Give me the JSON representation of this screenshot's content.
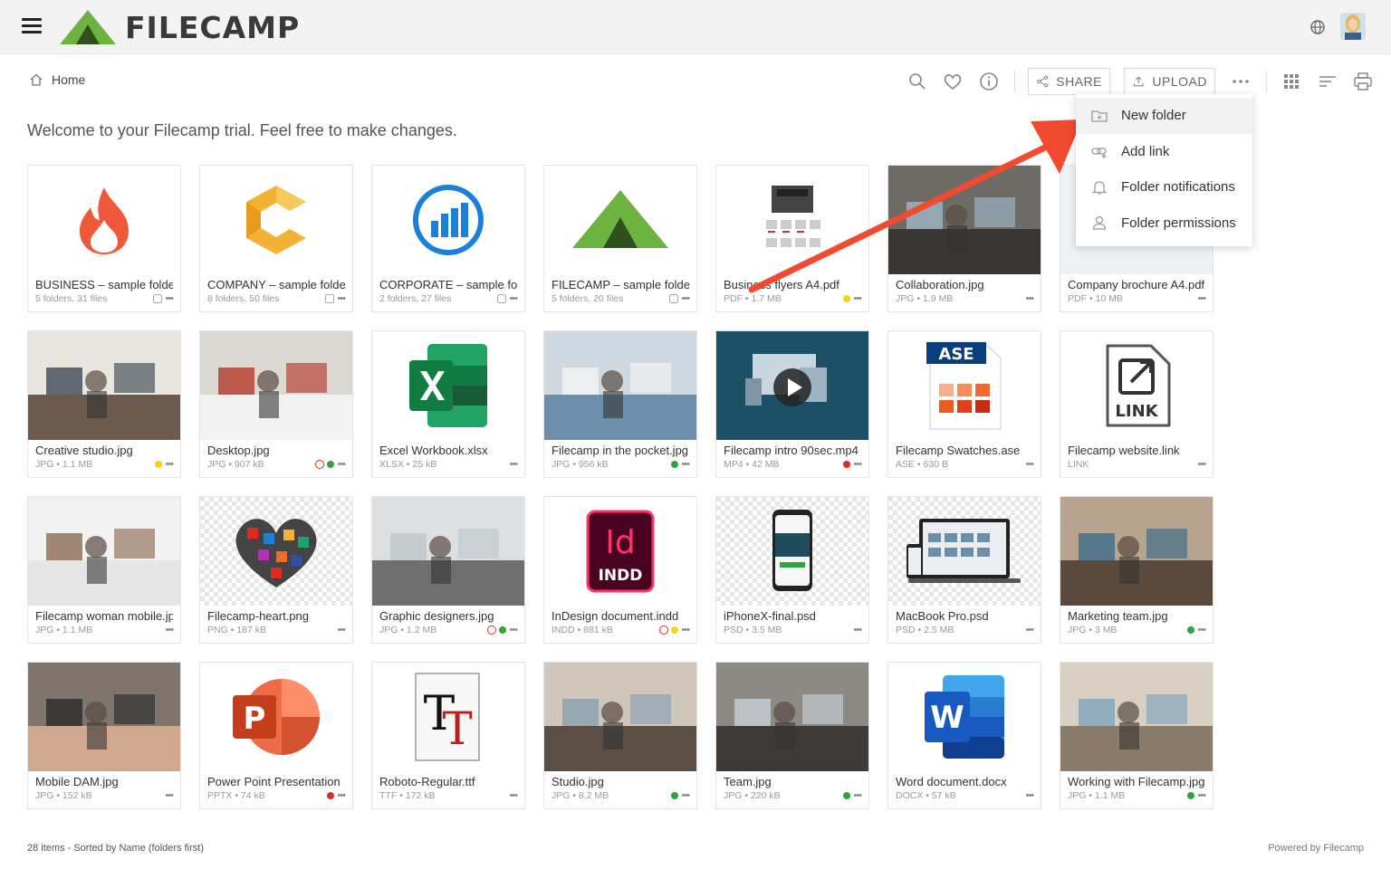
{
  "header": {
    "logo_text": "FILECAMP",
    "icons": [
      "menu-icon",
      "globe-icon",
      "user-avatar"
    ]
  },
  "breadcrumb": {
    "home_label": "Home"
  },
  "toolbar": {
    "share_label": "SHARE",
    "upload_label": "UPLOAD",
    "icons": [
      "search-icon",
      "heart-icon",
      "info-icon",
      "more-icon",
      "grid-view-icon",
      "sort-icon",
      "print-icon"
    ]
  },
  "welcome": "Welcome to your Filecamp trial. Feel free to make changes.",
  "menu": {
    "items": [
      {
        "label": "New folder",
        "icon": "new-folder-icon"
      },
      {
        "label": "Add link",
        "icon": "link-icon"
      },
      {
        "label": "Folder notifications",
        "icon": "bell-icon"
      },
      {
        "label": "Folder permissions",
        "icon": "user-icon"
      }
    ]
  },
  "items": [
    {
      "name": "BUSINESS – sample folder",
      "meta": "5 folders, 31 files",
      "kind": "folder-fire",
      "status": ""
    },
    {
      "name": "COMPANY – sample folder",
      "meta": "8 folders, 50 files",
      "kind": "folder-c",
      "status": ""
    },
    {
      "name": "CORPORATE – sample folder",
      "meta": "2 folders, 27 files",
      "kind": "folder-chart",
      "status": ""
    },
    {
      "name": "FILECAMP – sample folder",
      "meta": "5 folders, 20 files",
      "kind": "folder-filecamp",
      "status": ""
    },
    {
      "name": "Business flyers A4.pdf",
      "meta": "PDF • 1.7 MB",
      "kind": "flyer",
      "status": "yellow"
    },
    {
      "name": "Collaboration.jpg",
      "meta": "JPG • 1.9 MB",
      "kind": "photo-office",
      "status": ""
    },
    {
      "name": "Company brochure A4.pdf",
      "meta": "PDF • 10 MB",
      "kind": "brochure",
      "status": ""
    },
    {
      "name": "Creative studio.jpg",
      "meta": "JPG • 1.1 MB",
      "kind": "photo-studio",
      "status": "yellow"
    },
    {
      "name": "Desktop.jpg",
      "meta": "JPG • 907 kB",
      "kind": "photo-desk",
      "status": "clock-green"
    },
    {
      "name": "Excel Workbook.xlsx",
      "meta": "XLSX • 25 kB",
      "kind": "excel",
      "status": ""
    },
    {
      "name": "Filecamp in the pocket.jpg",
      "meta": "JPG • 956 kB",
      "kind": "photo-pocket",
      "status": "green"
    },
    {
      "name": "Filecamp intro 90sec.mp4",
      "meta": "MP4 • 42 MB",
      "kind": "video",
      "status": "red"
    },
    {
      "name": "Filecamp Swatches.ase",
      "meta": "ASE • 630 B",
      "kind": "ase",
      "status": ""
    },
    {
      "name": "Filecamp website.link",
      "meta": "LINK",
      "kind": "link",
      "status": ""
    },
    {
      "name": "Filecamp woman mobile.jpg",
      "meta": "JPG • 1.1 MB",
      "kind": "photo-woman",
      "status": ""
    },
    {
      "name": "Filecamp-heart.png",
      "meta": "PNG • 187 kB",
      "kind": "heart",
      "status": ""
    },
    {
      "name": "Graphic designers.jpg",
      "meta": "JPG • 1.2 MB",
      "kind": "photo-designers",
      "status": "clock-green"
    },
    {
      "name": "InDesign document.indd",
      "meta": "INDD • 881 kB",
      "kind": "indd",
      "status": "clock-yellow"
    },
    {
      "name": "iPhoneX-final.psd",
      "meta": "PSD • 3.5 MB",
      "kind": "iphone",
      "status": ""
    },
    {
      "name": "MacBook Pro.psd",
      "meta": "PSD • 2.5 MB",
      "kind": "macbook",
      "status": ""
    },
    {
      "name": "Marketing team.jpg",
      "meta": "JPG • 3 MB",
      "kind": "photo-marketing",
      "status": "green"
    },
    {
      "name": "Mobile DAM.jpg",
      "meta": "JPG • 152 kB",
      "kind": "photo-mobile",
      "status": ""
    },
    {
      "name": "Power Point Presentation",
      "meta": "PPTX • 74 kB",
      "kind": "pptx",
      "status": "red"
    },
    {
      "name": "Roboto-Regular.ttf",
      "meta": "TTF • 172 kB",
      "kind": "ttf",
      "status": ""
    },
    {
      "name": "Studio.jpg",
      "meta": "JPG • 8.2 MB",
      "kind": "photo-studio2",
      "status": "green"
    },
    {
      "name": "Team.jpg",
      "meta": "JPG • 220 kB",
      "kind": "photo-team",
      "status": "green"
    },
    {
      "name": "Word document.docx",
      "meta": "DOCX • 57 kB",
      "kind": "word",
      "status": ""
    },
    {
      "name": "Working with Filecamp.jpg",
      "meta": "JPG • 1.1 MB",
      "kind": "photo-working",
      "status": "green"
    }
  ],
  "footer": {
    "left": "28 items - Sorted by Name (folders first)",
    "right": "Powered by Filecamp"
  },
  "colors": {
    "logo_green": "#6cb33f",
    "arrow_red": "#f04a2f",
    "status_green": "#2da53a",
    "status_yellow": "#f5d312",
    "status_red": "#e02b20"
  }
}
